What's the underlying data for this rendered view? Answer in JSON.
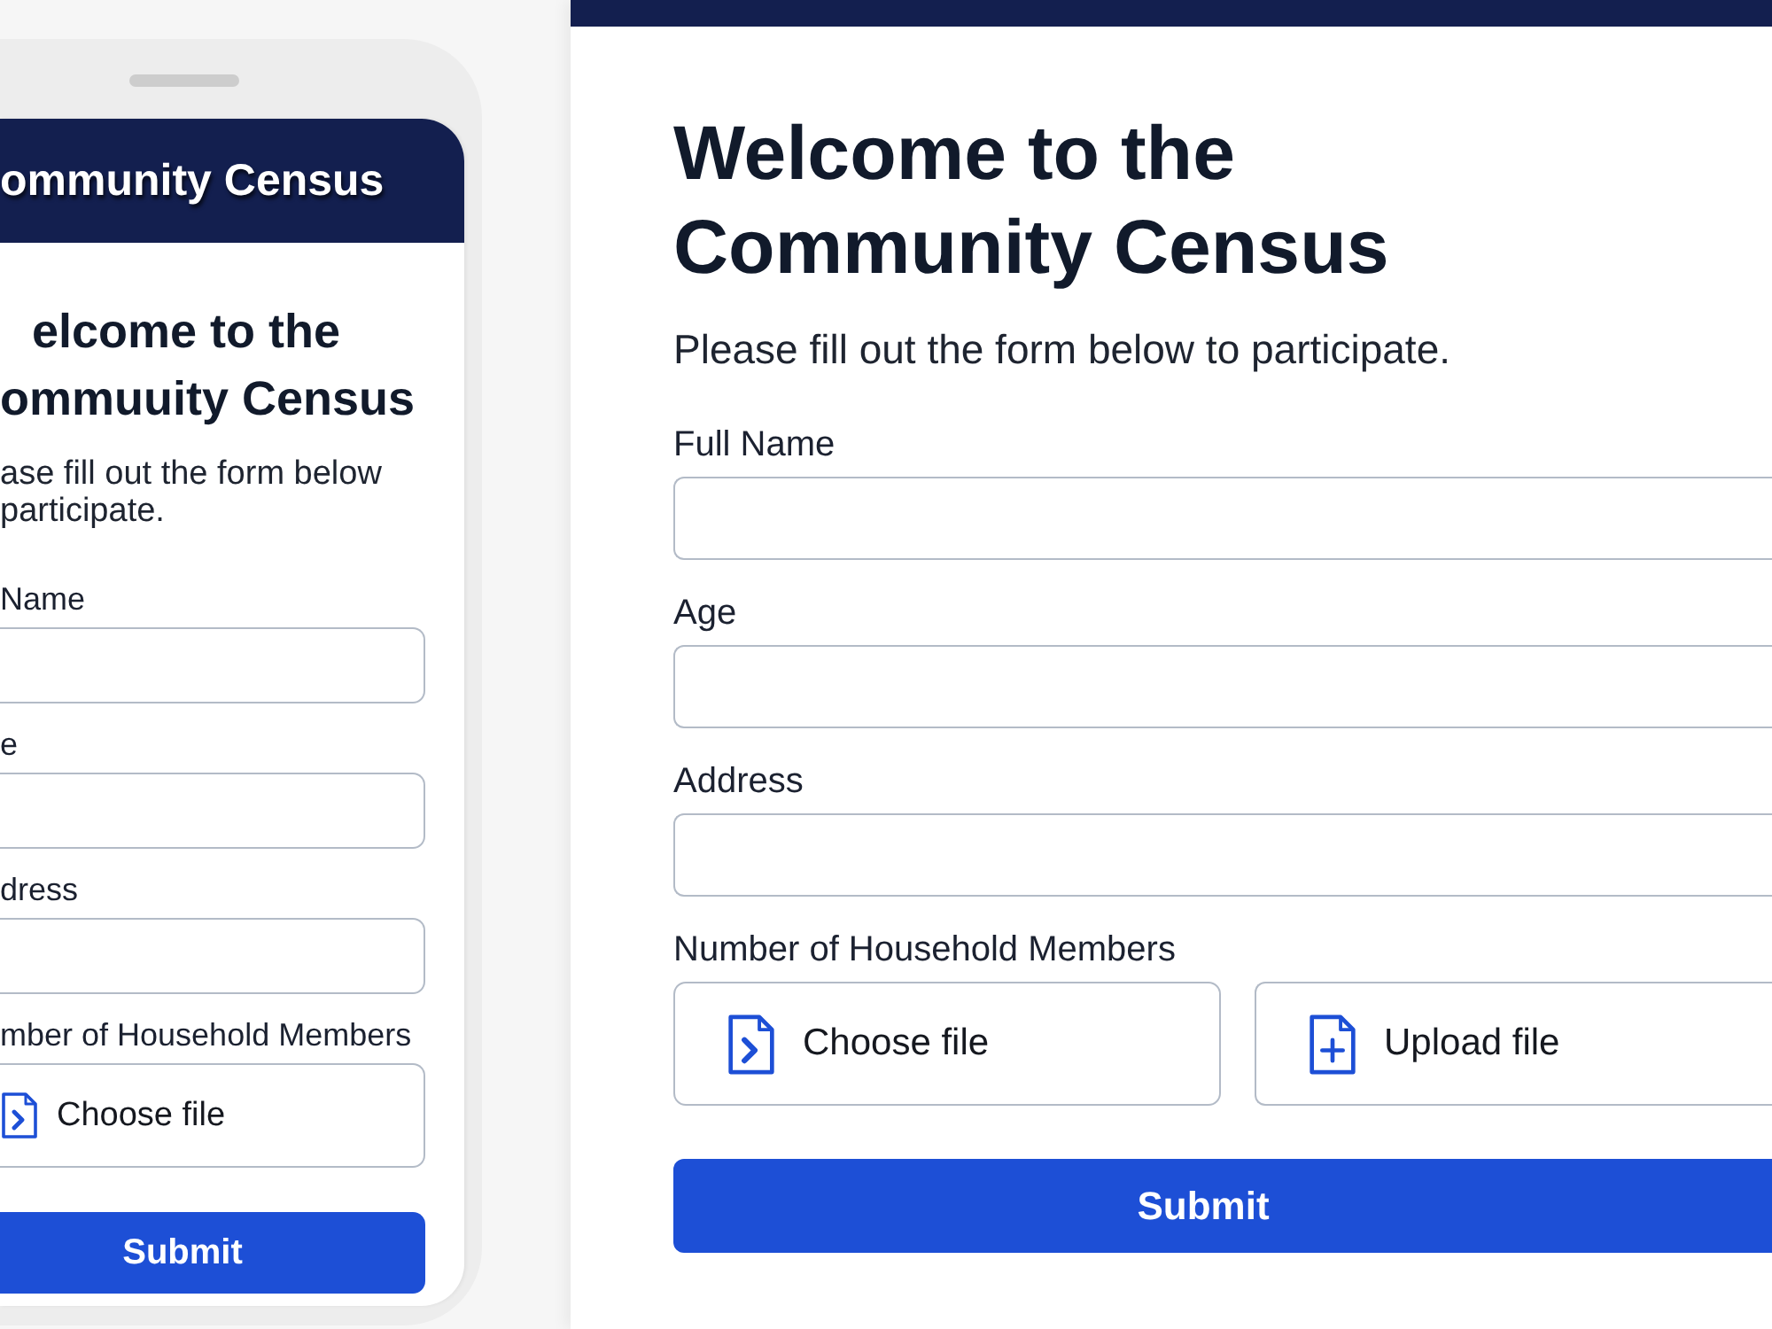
{
  "phone": {
    "header": {
      "title": "ommunity Census"
    },
    "heading": "elcome to the ommuuity Census",
    "intro": "ase fill out the form below participate.",
    "fields": [
      {
        "label": "Name",
        "kind": "text"
      },
      {
        "label": "e",
        "kind": "text"
      },
      {
        "label": "dress",
        "kind": "text"
      },
      {
        "label": "mber of Household Members",
        "kind": "file",
        "buttons": [
          {
            "label": "Choose file",
            "kind": "choose"
          }
        ]
      }
    ],
    "submit": "Submit"
  },
  "desktop": {
    "heading": "Welcome to the Community Census",
    "intro": "Please fill out the form below to participate.",
    "fields": [
      {
        "label": "Full Name",
        "kind": "text"
      },
      {
        "label": "Age",
        "kind": "text"
      },
      {
        "label": "Address",
        "kind": "text"
      },
      {
        "label": "Number of Household Members",
        "kind": "file",
        "buttons": [
          {
            "label": "Choose file",
            "kind": "choose"
          },
          {
            "label": "Upload file",
            "kind": "upload"
          }
        ]
      }
    ],
    "submit": "Submit"
  }
}
